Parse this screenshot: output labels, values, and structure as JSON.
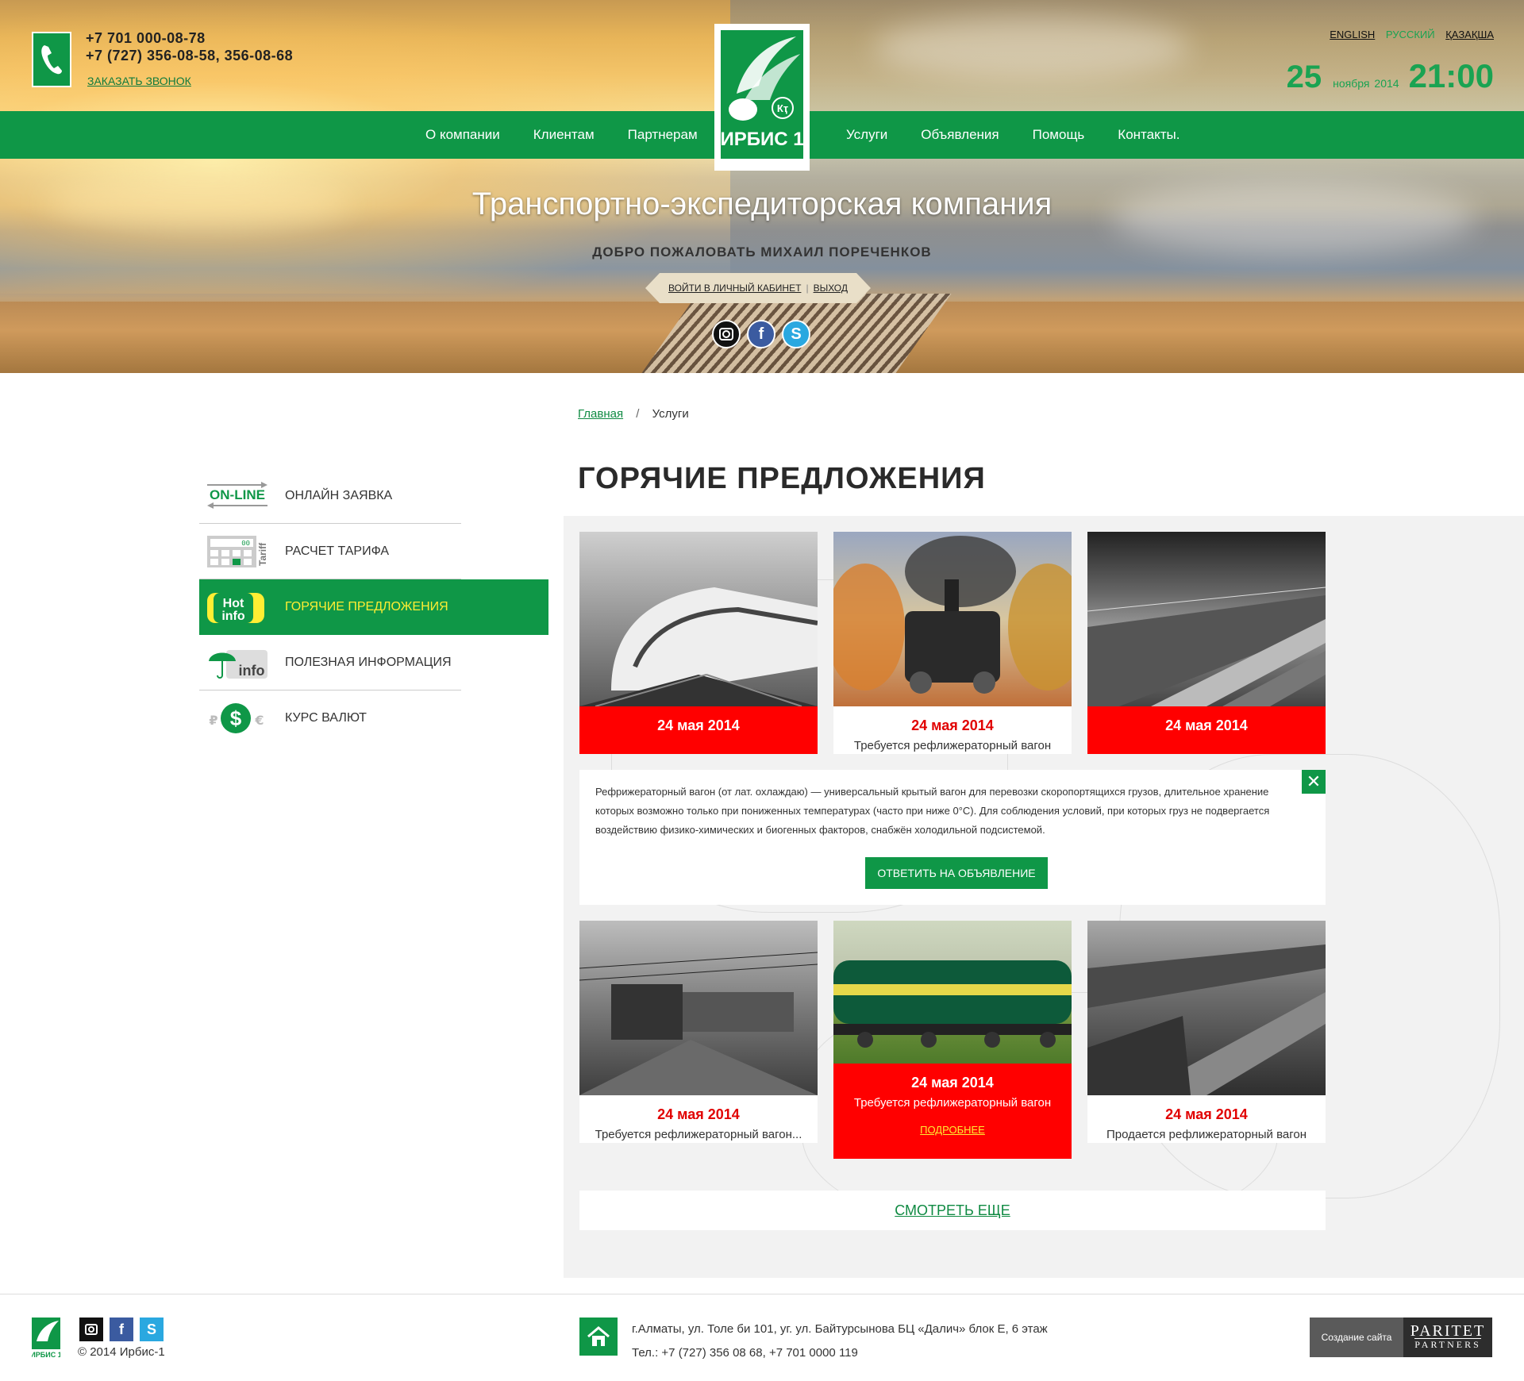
{
  "header": {
    "phone1": "+7 701 000-08-78",
    "phone2": "+7 (727) 356-08-58, 356-08-68",
    "callback": "ЗАКАЗАТЬ ЗВОНОК",
    "logo_text": "ИРБИС 1",
    "logo_badge": "Кҭ",
    "nav_left": [
      "О компании",
      "Клиентам",
      "Партнерам"
    ],
    "nav_right": [
      "Услуги",
      "Объявления",
      "Помощь",
      "Контакты."
    ],
    "languages": [
      "ENGLISH",
      "РУССКИЙ",
      "ҚАЗАҚША"
    ],
    "date": {
      "day": "25",
      "month": "ноября",
      "year": "2014",
      "time": "21:00"
    }
  },
  "hero": {
    "title": "Транспортно-экспедиторская компания",
    "welcome": "ДОБРО ПОЖАЛОВАТЬ МИХАИЛ ПОРЕЧЕНКОВ",
    "cabinet": "ВОЙТИ В ЛИЧНЫЙ КАБИНЕТ",
    "logout": "ВЫХОД",
    "social": [
      "instagram-icon",
      "facebook-icon",
      "skype-icon"
    ]
  },
  "breadcrumb": {
    "home": "Главная",
    "current": "Услуги"
  },
  "page_title": "ГОРЯЧИЕ ПРЕДЛОЖЕНИЯ",
  "sidebar": {
    "items": [
      {
        "label": "ОНЛАЙН ЗАЯВКА",
        "icon": "ON-LINE"
      },
      {
        "label": "РАСЧЕТ ТАРИФА",
        "icon": "Tariff"
      },
      {
        "label": "ГОРЯЧИЕ ПРЕДЛОЖЕНИЯ",
        "icon": "Hot info"
      },
      {
        "label": "ПОЛЕЗНАЯ ИНФОРМАЦИЯ",
        "icon": "info"
      },
      {
        "label": "КУРС ВАЛЮТ",
        "icon": "₽$€"
      }
    ]
  },
  "cards": [
    {
      "date": "24 мая 2014",
      "desc": ""
    },
    {
      "date": "24 мая 2014",
      "desc": "Требуется рефлижераторный вагон"
    },
    {
      "date": "24 мая 2014",
      "desc": ""
    },
    {
      "date": "24 мая 2014",
      "desc": "Требуется рефлижераторный вагон..."
    },
    {
      "date": "24 мая 2014",
      "desc": "Требуется рефлижераторный вагон",
      "more": "ПОДРОБНЕЕ"
    },
    {
      "date": "24 мая 2014",
      "desc": "Продается рефлижераторный вагон"
    }
  ],
  "detail": {
    "text": "Рефрижераторный вагон (от лат.  охлаждаю) — универсальный крытый вагон для перевозки скоропортящихся грузов, длительное хранение которых возможно только при пониженных температурах (часто при ниже 0°C). Для соблюдения условий, при которых груз не подвергается воздействию физико-химических и биогенных факторов, снабжён холодильной подсистемой.",
    "reply": "ОТВЕТИТЬ НА ОБЪЯВЛЕНИЕ",
    "close": "✕"
  },
  "see_more": "СМОТРЕТЬ ЕЩЕ",
  "footer": {
    "logo_text": "ИРБИС 1",
    "copyright": "© 2014  Ирбис-1",
    "address": "г.Алматы, ул. Толе би 101, уг. ул. Байтурсынова БЦ «Далич» блок Е, 6 этаж",
    "phones": "Тел.: +7 (727) 356 08 68, +7 701 0000 119",
    "dev_label": "Создание сайта",
    "dev_brand1": "PARITET",
    "dev_brand2": "PARTNERS"
  },
  "colors": {
    "green": "#0f9747",
    "red": "#ff0000",
    "accent_yellow": "#ffee33"
  }
}
